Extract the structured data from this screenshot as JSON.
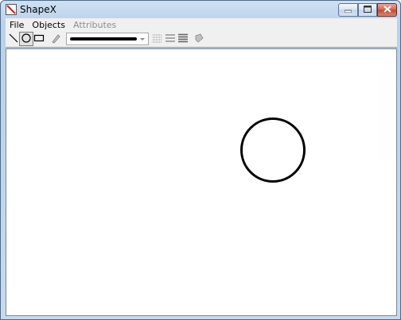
{
  "window": {
    "title": "ShapeX",
    "icon": "app-logo-icon",
    "controls": [
      "minimize-icon",
      "maximize-icon",
      "close-icon"
    ]
  },
  "menu": {
    "items": [
      {
        "label": "File",
        "enabled": true
      },
      {
        "label": "Objects",
        "enabled": true
      },
      {
        "label": "Attributes",
        "enabled": false
      }
    ]
  },
  "toolbar": {
    "tools": [
      {
        "name": "line-tool",
        "icon": "line-icon",
        "pressed": false
      },
      {
        "name": "ellipse-tool",
        "icon": "ellipse-icon",
        "pressed": true
      },
      {
        "name": "rectangle-tool",
        "icon": "rectangle-icon",
        "pressed": false
      },
      {
        "name": "pen-tool",
        "icon": "pen-icon",
        "pressed": false
      },
      {
        "name": "line-width-dropdown",
        "icon": "thick-line-swatch"
      },
      {
        "name": "dotted-line-style",
        "icon": "dotted-lines-icon",
        "pressed": false
      },
      {
        "name": "medium-line-style",
        "icon": "medium-lines-icon",
        "pressed": false
      },
      {
        "name": "bold-line-style",
        "icon": "bold-lines-icon",
        "pressed": false
      },
      {
        "name": "fill-tool",
        "icon": "fill-icon",
        "pressed": false
      }
    ],
    "line_width_value": "thick"
  },
  "canvas": {
    "shapes": [
      {
        "type": "circle",
        "stroke": "#000000",
        "fill": "none"
      }
    ]
  },
  "colors": {
    "titlebar": "#c6d9ee",
    "close_button": "#c44630",
    "canvas": "#ffffff",
    "shape_stroke": "#000000"
  }
}
